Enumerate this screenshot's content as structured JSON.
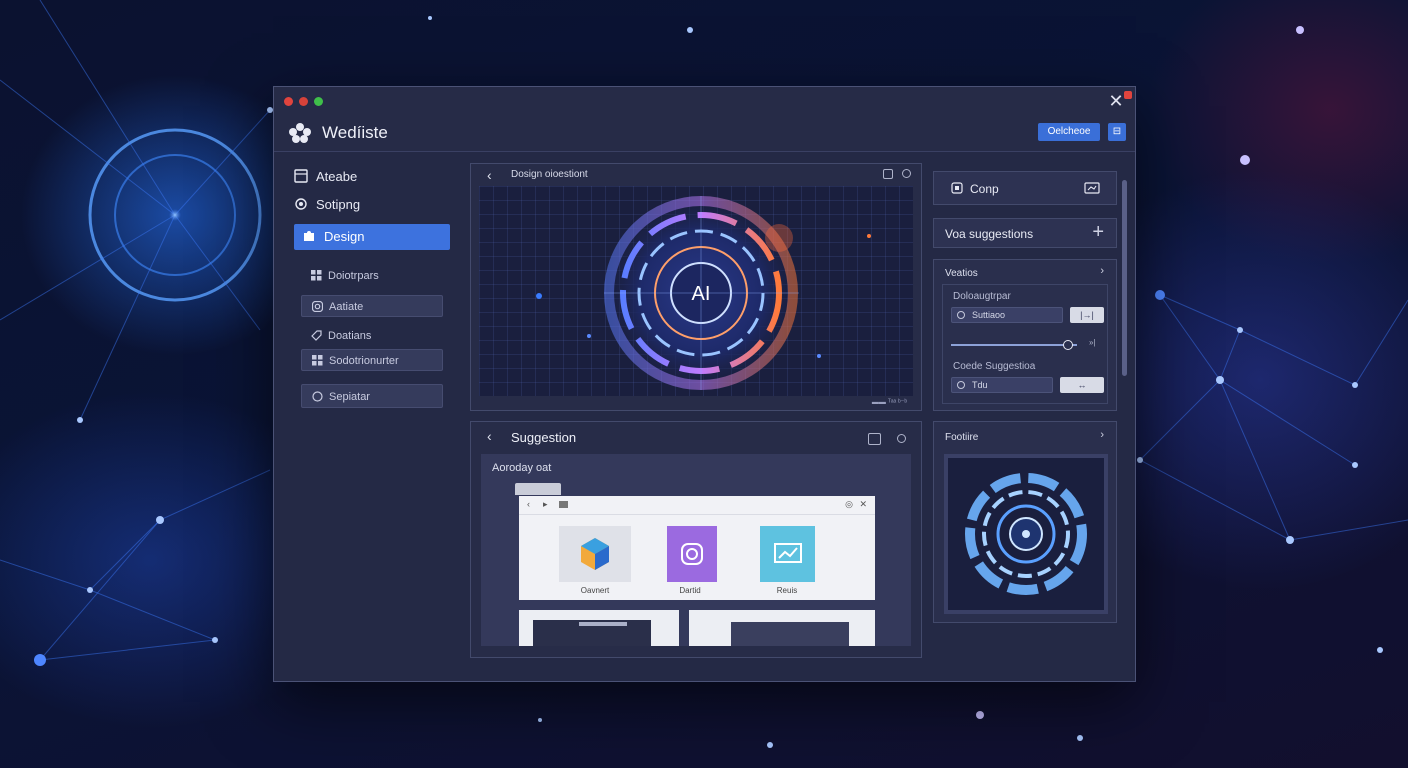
{
  "window": {
    "app_title": "Wedíiste",
    "primary_button": "Oelcheoe",
    "icon_button": "⊟"
  },
  "sidebar": {
    "items": [
      {
        "label": "Ateabe",
        "icon": "square-icon"
      },
      {
        "label": "Sotipng",
        "icon": "gear-icon"
      },
      {
        "label": "Design",
        "icon": "puzzle-icon",
        "active": true
      }
    ],
    "subitems": [
      {
        "label": "Doiotrpars",
        "icon": "grid-icon",
        "boxed": false
      },
      {
        "label": "Aatiate",
        "icon": "camera-icon",
        "boxed": true
      },
      {
        "label": "Doatians",
        "icon": "tag-icon",
        "boxed": false
      },
      {
        "label": "Sodotrionurter",
        "icon": "grid-icon",
        "boxed": true
      },
      {
        "label": "Sepiatar",
        "icon": "circle-icon",
        "boxed": true
      }
    ]
  },
  "preview_panel": {
    "title": "Dosign oioestiont",
    "ai_label": "AI",
    "footer": "▬▬ ᵀᵃᵃ ᵇ⁻ᵇ"
  },
  "suggestion_panel": {
    "title": "Suggestion",
    "label": "Aoroday oat",
    "cards": [
      {
        "label": "Oavnert"
      },
      {
        "label": "Dartid"
      },
      {
        "label": "Reuis"
      }
    ]
  },
  "right_panel": {
    "comp_label": "Conp",
    "suggestion_label": "Voa suggestions",
    "variants": {
      "title": "Veatios",
      "section_label": "Doloaugtrpar",
      "field1": "Suttiaoo",
      "field1_btn": "|→|",
      "slider_value": 0.92,
      "slider_end": "»|",
      "section2_label": "Coede Suggestioa",
      "field2": "Tdu",
      "field2_btn": "↔"
    },
    "footure": {
      "title": "Footiire"
    }
  }
}
